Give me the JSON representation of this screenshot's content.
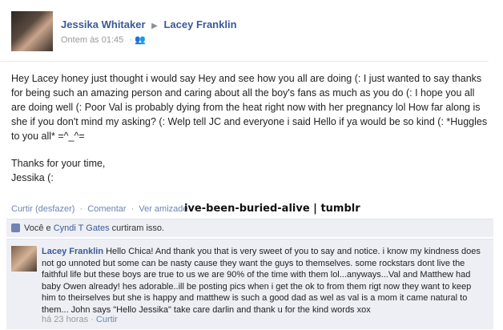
{
  "post": {
    "author": "Jessika Whitaker",
    "target": "Lacey Franklin",
    "timestamp": "Ontem às 01:45",
    "privacy_icon": "friends-icon",
    "paragraph1": "Hey Lacey honey just thought i would say Hey and see how you all are doing (: I just wanted to say thanks for being such an amazing person and caring about all the boy's fans as much as you do (: I hope you all are doing well (: Poor Val is probably dying from the heat right now with her pregnancy lol How far along is she if you don't mind my asking? (: Welp tell JC and everyone i said Hello if ya would be so kind (: *Huggles to you all* =^_^=",
    "signoff1": "Thanks for your time,",
    "signoff2": "Jessika (:"
  },
  "actions": {
    "like": "Curtir (desfazer)",
    "comment": "Comentar",
    "friendship": "Ver amizade",
    "separator": "·"
  },
  "watermark": "ive-been-buried-alive | tumblr",
  "likes": {
    "prefix": "Você e ",
    "person": "Cyndi T Gates",
    "suffix": " curtiram isso."
  },
  "comment": {
    "author": "Lacey Franklin",
    "text": "Hello Chica! And thank you that is very sweet of you to say and notice. i know my kindness does not go unnoted but some can be nasty cause they want the guys to themselves. some rockstars dont live the faithful life but these boys are true to us we are 90% of the time with them lol...anyways...Val and Matthew had baby Owen already! hes adorable..ill be posting pics when i get the ok to from them rigt now they want to keep him to theirselves but she is happy and matthew is such a good dad as wel as val is a mom it came natural to them... John says \"Hello Jessika\" take care darlin and thank u for the kind words xox",
    "time": "há 23 horas",
    "like": "Curtir"
  }
}
